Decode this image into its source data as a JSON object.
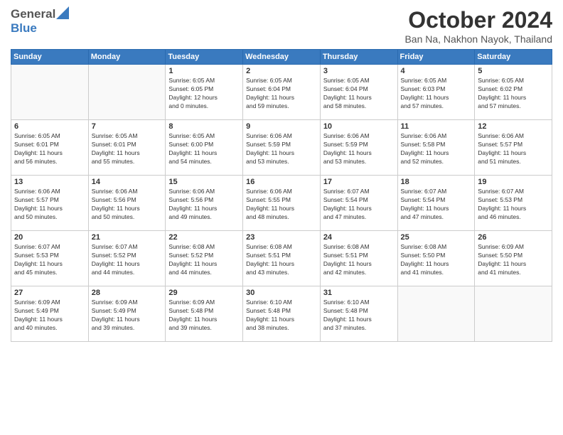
{
  "header": {
    "logo_general": "General",
    "logo_blue": "Blue",
    "month_title": "October 2024",
    "location": "Ban Na, Nakhon Nayok, Thailand"
  },
  "weekdays": [
    "Sunday",
    "Monday",
    "Tuesday",
    "Wednesday",
    "Thursday",
    "Friday",
    "Saturday"
  ],
  "weeks": [
    [
      {
        "day": "",
        "info": ""
      },
      {
        "day": "",
        "info": ""
      },
      {
        "day": "1",
        "info": "Sunrise: 6:05 AM\nSunset: 6:05 PM\nDaylight: 12 hours\nand 0 minutes."
      },
      {
        "day": "2",
        "info": "Sunrise: 6:05 AM\nSunset: 6:04 PM\nDaylight: 11 hours\nand 59 minutes."
      },
      {
        "day": "3",
        "info": "Sunrise: 6:05 AM\nSunset: 6:04 PM\nDaylight: 11 hours\nand 58 minutes."
      },
      {
        "day": "4",
        "info": "Sunrise: 6:05 AM\nSunset: 6:03 PM\nDaylight: 11 hours\nand 57 minutes."
      },
      {
        "day": "5",
        "info": "Sunrise: 6:05 AM\nSunset: 6:02 PM\nDaylight: 11 hours\nand 57 minutes."
      }
    ],
    [
      {
        "day": "6",
        "info": "Sunrise: 6:05 AM\nSunset: 6:01 PM\nDaylight: 11 hours\nand 56 minutes."
      },
      {
        "day": "7",
        "info": "Sunrise: 6:05 AM\nSunset: 6:01 PM\nDaylight: 11 hours\nand 55 minutes."
      },
      {
        "day": "8",
        "info": "Sunrise: 6:05 AM\nSunset: 6:00 PM\nDaylight: 11 hours\nand 54 minutes."
      },
      {
        "day": "9",
        "info": "Sunrise: 6:06 AM\nSunset: 5:59 PM\nDaylight: 11 hours\nand 53 minutes."
      },
      {
        "day": "10",
        "info": "Sunrise: 6:06 AM\nSunset: 5:59 PM\nDaylight: 11 hours\nand 53 minutes."
      },
      {
        "day": "11",
        "info": "Sunrise: 6:06 AM\nSunset: 5:58 PM\nDaylight: 11 hours\nand 52 minutes."
      },
      {
        "day": "12",
        "info": "Sunrise: 6:06 AM\nSunset: 5:57 PM\nDaylight: 11 hours\nand 51 minutes."
      }
    ],
    [
      {
        "day": "13",
        "info": "Sunrise: 6:06 AM\nSunset: 5:57 PM\nDaylight: 11 hours\nand 50 minutes."
      },
      {
        "day": "14",
        "info": "Sunrise: 6:06 AM\nSunset: 5:56 PM\nDaylight: 11 hours\nand 50 minutes."
      },
      {
        "day": "15",
        "info": "Sunrise: 6:06 AM\nSunset: 5:56 PM\nDaylight: 11 hours\nand 49 minutes."
      },
      {
        "day": "16",
        "info": "Sunrise: 6:06 AM\nSunset: 5:55 PM\nDaylight: 11 hours\nand 48 minutes."
      },
      {
        "day": "17",
        "info": "Sunrise: 6:07 AM\nSunset: 5:54 PM\nDaylight: 11 hours\nand 47 minutes."
      },
      {
        "day": "18",
        "info": "Sunrise: 6:07 AM\nSunset: 5:54 PM\nDaylight: 11 hours\nand 47 minutes."
      },
      {
        "day": "19",
        "info": "Sunrise: 6:07 AM\nSunset: 5:53 PM\nDaylight: 11 hours\nand 46 minutes."
      }
    ],
    [
      {
        "day": "20",
        "info": "Sunrise: 6:07 AM\nSunset: 5:53 PM\nDaylight: 11 hours\nand 45 minutes."
      },
      {
        "day": "21",
        "info": "Sunrise: 6:07 AM\nSunset: 5:52 PM\nDaylight: 11 hours\nand 44 minutes."
      },
      {
        "day": "22",
        "info": "Sunrise: 6:08 AM\nSunset: 5:52 PM\nDaylight: 11 hours\nand 44 minutes."
      },
      {
        "day": "23",
        "info": "Sunrise: 6:08 AM\nSunset: 5:51 PM\nDaylight: 11 hours\nand 43 minutes."
      },
      {
        "day": "24",
        "info": "Sunrise: 6:08 AM\nSunset: 5:51 PM\nDaylight: 11 hours\nand 42 minutes."
      },
      {
        "day": "25",
        "info": "Sunrise: 6:08 AM\nSunset: 5:50 PM\nDaylight: 11 hours\nand 41 minutes."
      },
      {
        "day": "26",
        "info": "Sunrise: 6:09 AM\nSunset: 5:50 PM\nDaylight: 11 hours\nand 41 minutes."
      }
    ],
    [
      {
        "day": "27",
        "info": "Sunrise: 6:09 AM\nSunset: 5:49 PM\nDaylight: 11 hours\nand 40 minutes."
      },
      {
        "day": "28",
        "info": "Sunrise: 6:09 AM\nSunset: 5:49 PM\nDaylight: 11 hours\nand 39 minutes."
      },
      {
        "day": "29",
        "info": "Sunrise: 6:09 AM\nSunset: 5:48 PM\nDaylight: 11 hours\nand 39 minutes."
      },
      {
        "day": "30",
        "info": "Sunrise: 6:10 AM\nSunset: 5:48 PM\nDaylight: 11 hours\nand 38 minutes."
      },
      {
        "day": "31",
        "info": "Sunrise: 6:10 AM\nSunset: 5:48 PM\nDaylight: 11 hours\nand 37 minutes."
      },
      {
        "day": "",
        "info": ""
      },
      {
        "day": "",
        "info": ""
      }
    ]
  ]
}
